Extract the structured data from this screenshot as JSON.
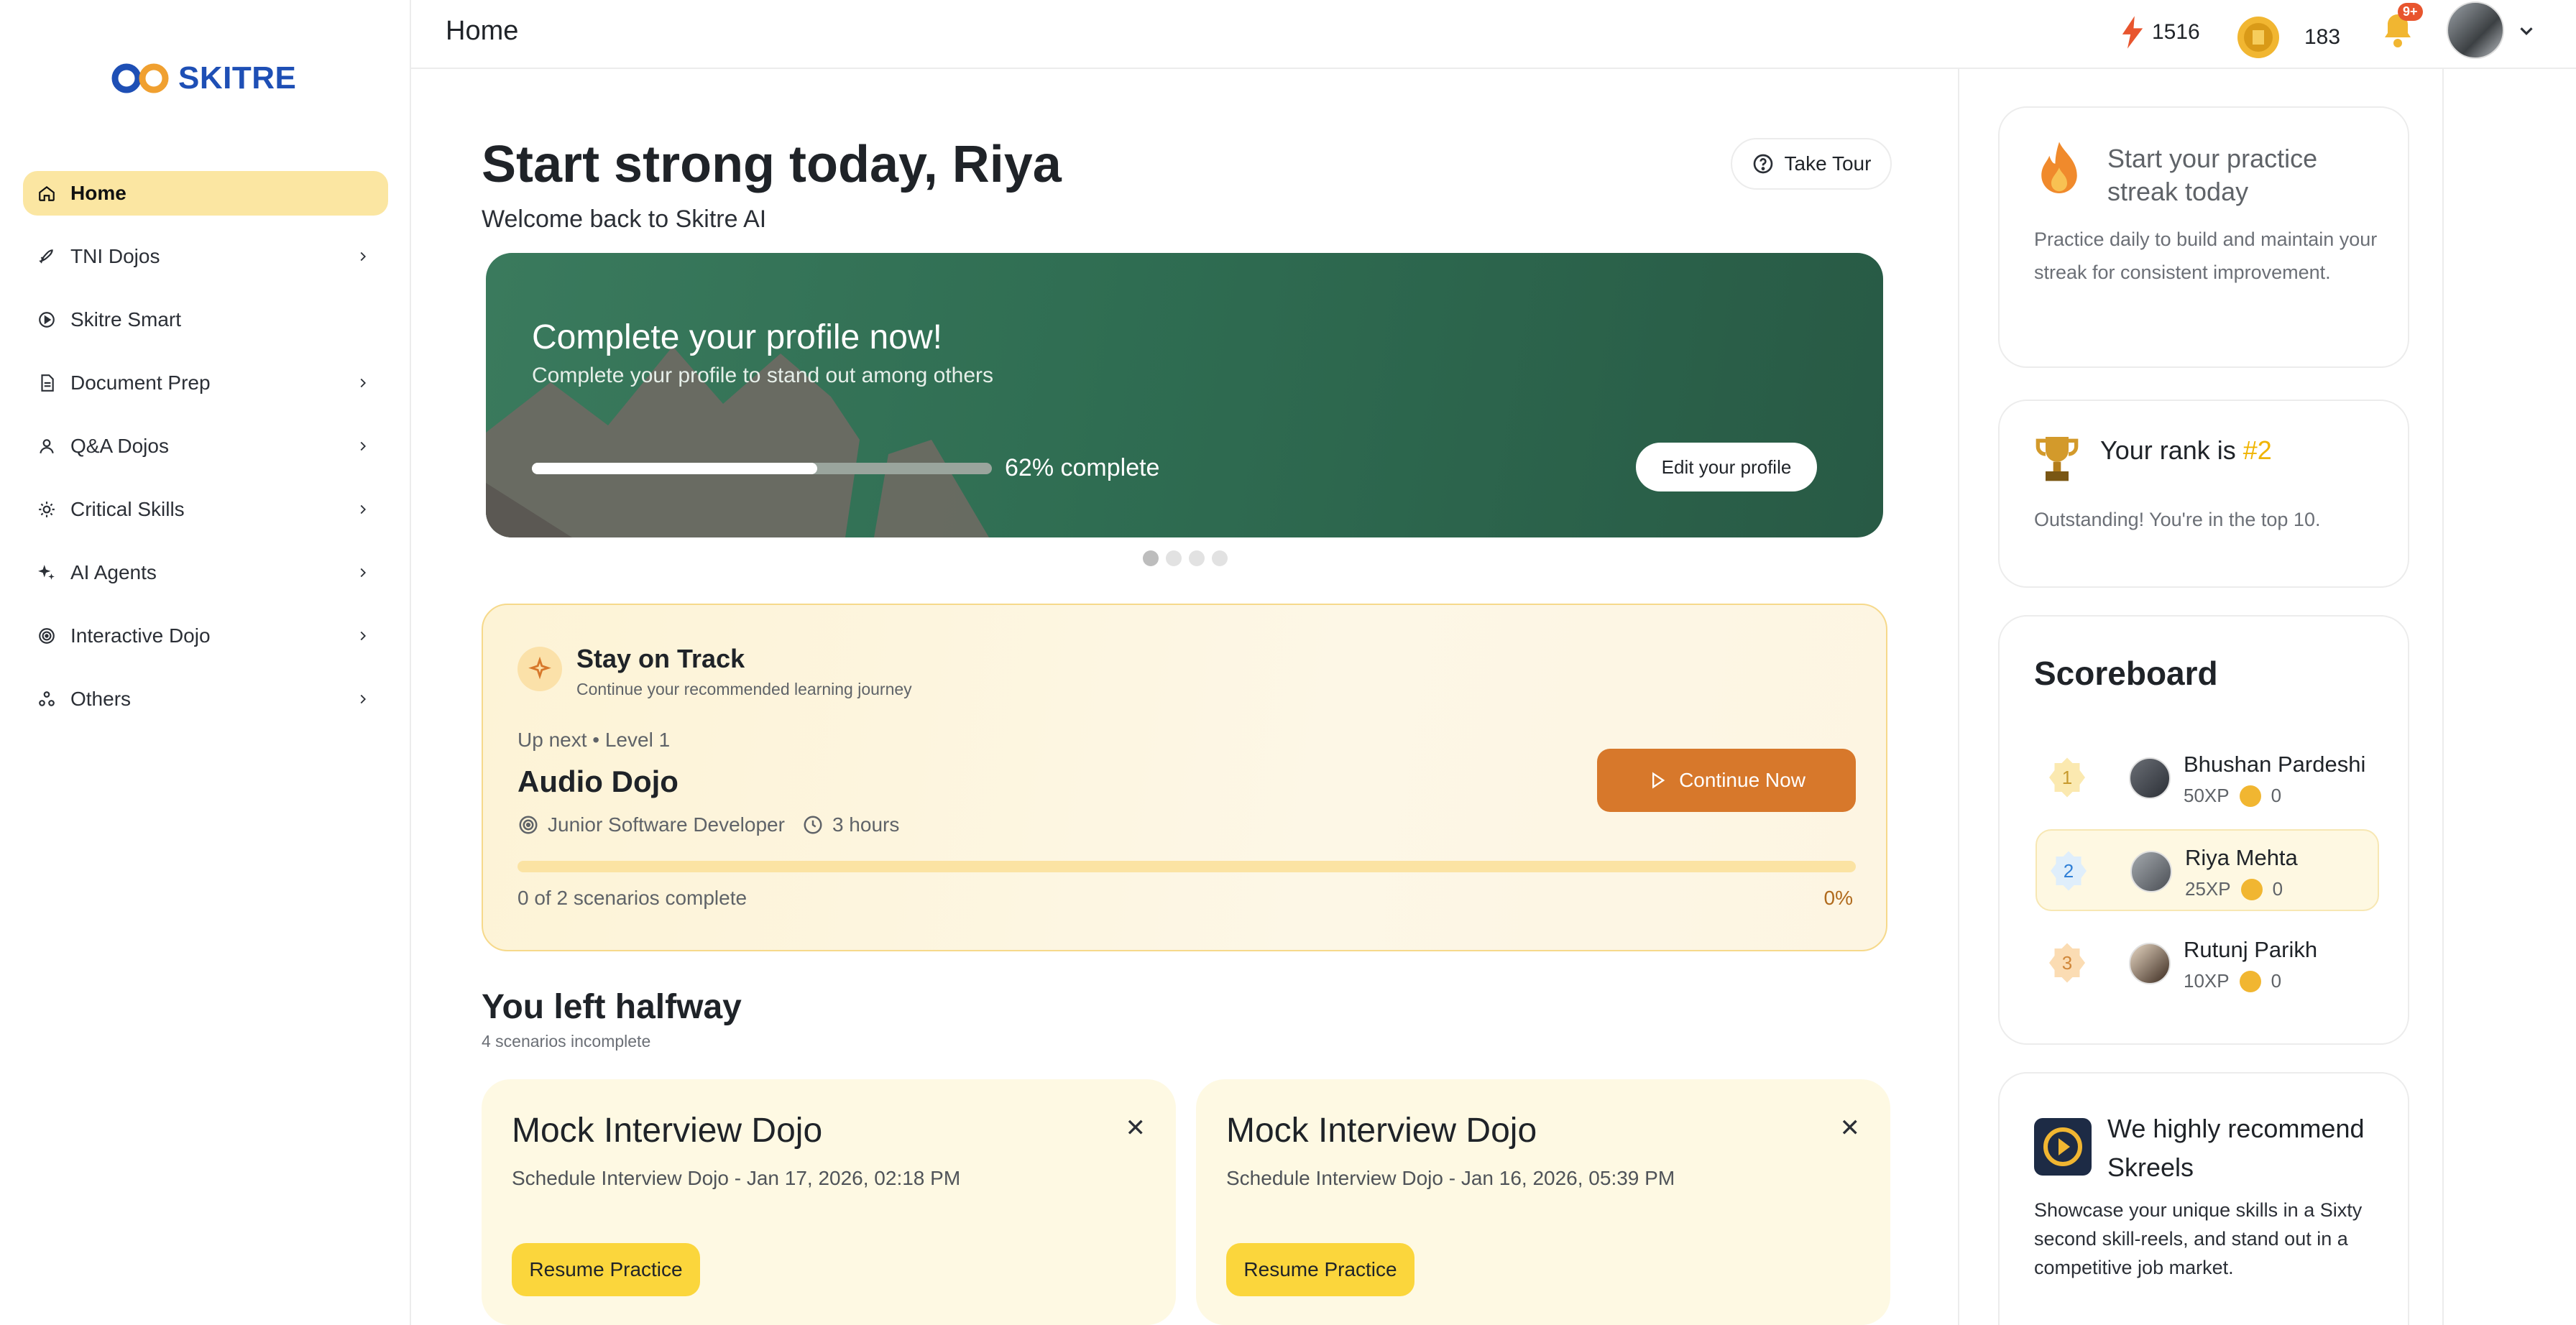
{
  "brand": {
    "name": "SKITRE"
  },
  "sidebar": {
    "items": [
      {
        "label": "Home",
        "icon": "home-icon",
        "active": true,
        "expandable": false
      },
      {
        "label": "TNI Dojos",
        "icon": "rocket-icon",
        "expandable": true
      },
      {
        "label": "Skitre Smart",
        "icon": "play-circle-icon",
        "expandable": false
      },
      {
        "label": "Document Prep",
        "icon": "document-icon",
        "expandable": true
      },
      {
        "label": "Q&A Dojos",
        "icon": "user-icon",
        "expandable": true
      },
      {
        "label": "Critical Skills",
        "icon": "bulb-icon",
        "expandable": true
      },
      {
        "label": "AI Agents",
        "icon": "sparkle-icon",
        "expandable": true
      },
      {
        "label": "Interactive Dojo",
        "icon": "target-icon",
        "expandable": true
      },
      {
        "label": "Others",
        "icon": "shapes-icon",
        "expandable": true
      }
    ]
  },
  "topbar": {
    "title": "Home",
    "xp": "1516",
    "coins": "183",
    "notifications_badge": "9+"
  },
  "hero": {
    "title": "Start strong today, Riya",
    "subtitle": "Welcome back to Skitre AI",
    "tour_label": "Take Tour"
  },
  "banner": {
    "title": "Complete your profile now!",
    "subtitle": "Complete your profile to stand out among others",
    "progress": 0.62,
    "progress_label": "62% complete",
    "button_label": "Edit your profile",
    "carousel_count": 4,
    "carousel_active": 0
  },
  "track": {
    "title": "Stay on Track",
    "subtitle": "Continue your recommended learning journey",
    "up_next": "Up next • Level 1",
    "dojo": "Audio Dojo",
    "role": "Junior Software Developer",
    "duration": "3 hours",
    "button_label": "Continue Now",
    "scenarios": "0 of 2 scenarios complete",
    "percent": "0%"
  },
  "halfway": {
    "title": "You left halfway",
    "subtitle": "4 scenarios incomplete",
    "cards": [
      {
        "title": "Mock Interview Dojo",
        "subtitle": "Schedule Interview Dojo - Jan 17, 2026, 02:18 PM",
        "button": "Resume Practice"
      },
      {
        "title": "Mock Interview Dojo",
        "subtitle": "Schedule Interview Dojo - Jan 16, 2026, 05:39 PM",
        "button": "Resume Practice"
      }
    ]
  },
  "streak": {
    "title": "Start your practice streak today",
    "body": "Practice daily to build and maintain your streak for consistent improvement."
  },
  "rank": {
    "prefix": "Your rank is ",
    "value": "#2",
    "body": "Outstanding! You're in the top 10."
  },
  "scoreboard": {
    "title": "Scoreboard",
    "rows": [
      {
        "rank": "1",
        "name": "Bhushan Pardeshi",
        "xp": "50XP",
        "coins": "0"
      },
      {
        "rank": "2",
        "name": "Riya Mehta",
        "xp": "25XP",
        "coins": "0",
        "highlight": true
      },
      {
        "rank": "3",
        "name": "Rutunj Parikh",
        "xp": "10XP",
        "coins": "0"
      }
    ]
  },
  "recommend": {
    "title": "We highly recommend Skreels",
    "body": "Showcase your unique skills in a Sixty second skill-reels, and stand out in a competitive job market."
  },
  "colors": {
    "accent_yellow": "#fbd63c",
    "orange": "#d7782b",
    "banner_green": "#2f6d52",
    "brand_blue": "#1e4fb5"
  }
}
